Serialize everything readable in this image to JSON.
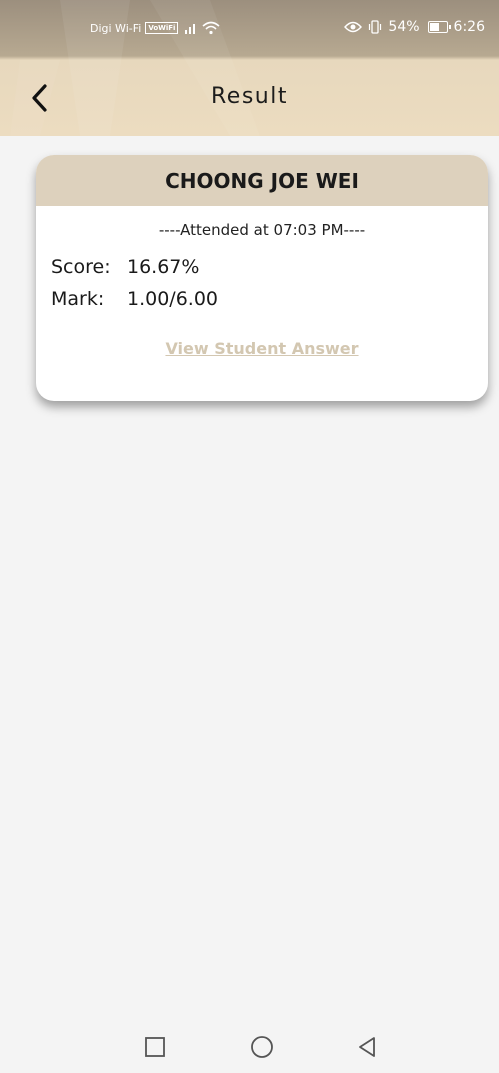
{
  "status_bar": {
    "carrier": "Digi Wi-Fi",
    "vowifi_badge": "VoWiFi",
    "battery_percent": "54%",
    "time": "6:26"
  },
  "app_bar": {
    "title": "Result",
    "back_icon": "chevron-left-icon"
  },
  "result_card": {
    "student_name": "CHOONG JOE WEI",
    "attended_text": "----Attended at 07:03 PM----",
    "score_label": "Score:",
    "score_value": "16.67%",
    "mark_label": "Mark:",
    "mark_value": "1.00/6.00",
    "view_answer_link": "View Student Answer"
  },
  "nav_bar": {
    "icons": [
      "square-recent-icon",
      "circle-home-icon",
      "triangle-back-icon"
    ]
  },
  "colors": {
    "header_bg": "#ecdcc0",
    "card_header_bg": "#ddd1bd",
    "link_color": "#d3c7b1"
  }
}
